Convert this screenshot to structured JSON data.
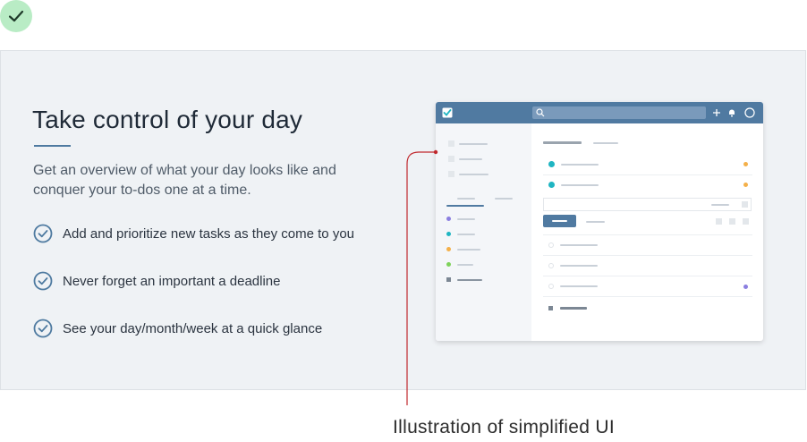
{
  "hero": {
    "title": "Take control of your day",
    "subtitle": "Get an overview of what your day looks like and conquer your to-dos one at a time."
  },
  "features": [
    {
      "label": "Add and prioritize new tasks as they come to you",
      "icon": "check-circle-icon"
    },
    {
      "label": "Never forget an important a deadline",
      "icon": "check-circle-icon"
    },
    {
      "label": "See your day/month/week at a quick glance",
      "icon": "check-circle-icon"
    }
  ],
  "annotation": {
    "caption": "Illustration of simplified UI",
    "line_color": "#c0282d"
  },
  "colors": {
    "badge": "#b9ecc5",
    "accent": "#507aa1",
    "panel": "#eff2f5",
    "teal": "#1fb5c2",
    "orange": "#f4b04a",
    "purple": "#8b7fe0",
    "green": "#7ed25a"
  },
  "mock_ui": {
    "icons": [
      "checkbox-logo-icon",
      "search-icon",
      "plus-icon",
      "bell-icon",
      "avatar-circle-icon"
    ]
  }
}
